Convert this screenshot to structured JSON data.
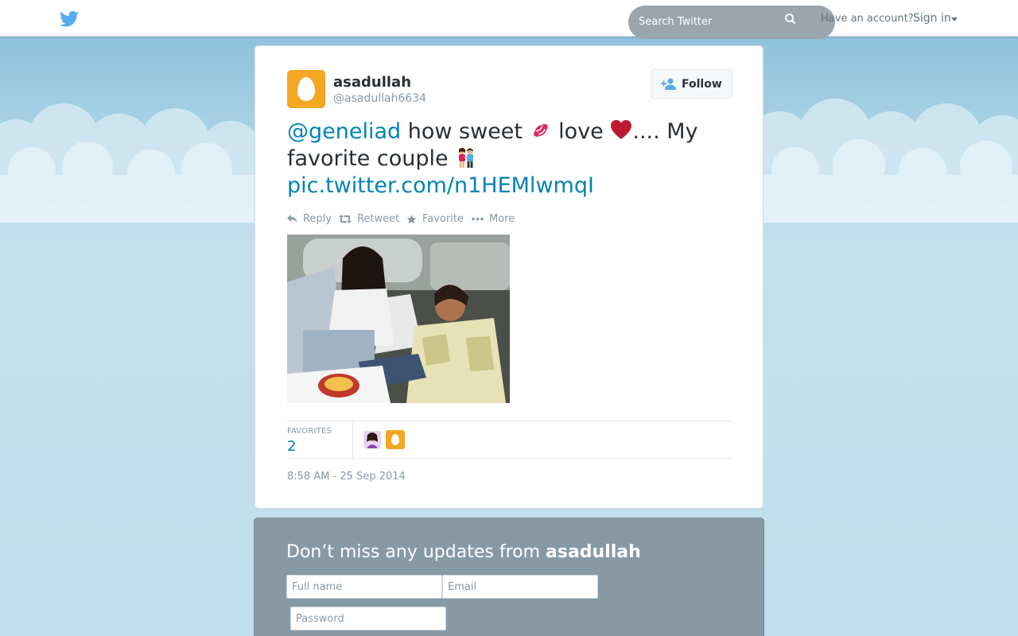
{
  "header": {
    "search_placeholder": "Search Twitter",
    "have_account": "Have an account?",
    "sign_in": "Sign in"
  },
  "tweet": {
    "author_name": "asadullah",
    "author_handle": "@asadullah6634",
    "follow_label": "Follow",
    "text_mention": "@geneliad",
    "text_part1": " how sweet ",
    "text_part2": " love ",
    "text_part3": ".... My favorite couple ",
    "text_link": "pic.twitter.com/n1HEMlwmqI",
    "actions": {
      "reply": "Reply",
      "retweet": "Retweet",
      "favorite": "Favorite",
      "more": "More"
    },
    "favorites_label": "FAVORITES",
    "favorites_count": "2",
    "timestamp": "8:58 AM - 25 Sep 2014"
  },
  "signup": {
    "title_prefix": "Don’t miss any updates from ",
    "title_name": "asadullah",
    "full_name_placeholder": "Full name",
    "email_placeholder": "Email",
    "password_placeholder": "Password"
  },
  "colors": {
    "link": "#0084b4",
    "egg_avatar": "#f5a623",
    "twitter_blue": "#55acee",
    "signup_bg": "#8899a6"
  }
}
